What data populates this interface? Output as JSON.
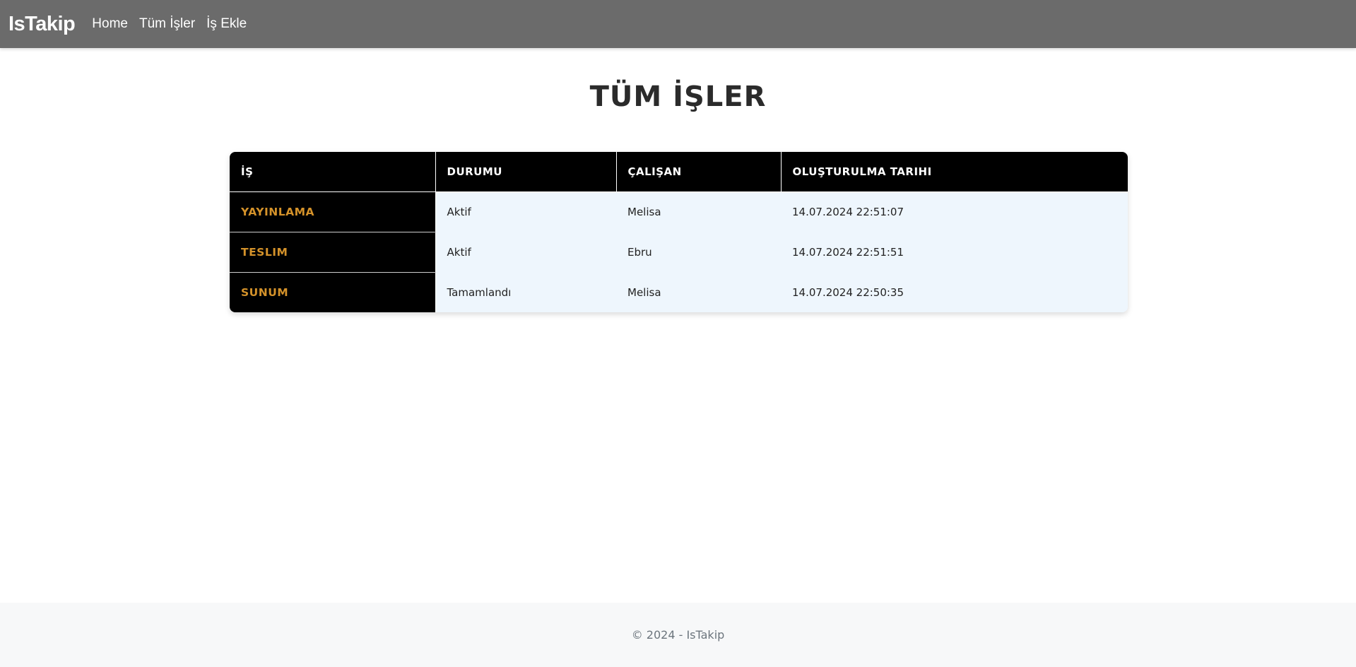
{
  "navbar": {
    "brand": "IsTakip",
    "links": [
      {
        "label": "Home"
      },
      {
        "label": "Tüm İşler"
      },
      {
        "label": "İş Ekle"
      }
    ],
    "background": "#6b6b6b"
  },
  "main": {
    "title": "TÜM İŞLER",
    "table": {
      "headers": [
        "İŞ",
        "DURUMU",
        "ÇALIŞAN",
        "OLUŞTURULMA TARIHI"
      ],
      "rows": [
        {
          "job": "YAYINLAMA",
          "status": "Aktif",
          "employee": "Melisa",
          "created": "14.07.2024 22:51:07"
        },
        {
          "job": "TESLIM",
          "status": "Aktif",
          "employee": "Ebru",
          "created": "14.07.2024 22:51:51"
        },
        {
          "job": "SUNUM",
          "status": "Tamamlandı",
          "employee": "Melisa",
          "created": "14.07.2024 22:50:35"
        }
      ],
      "colors": {
        "header_bg": "#000000",
        "job_text": "#d4922a",
        "row_bg": "#eef6fd"
      }
    }
  },
  "footer": {
    "text": "© 2024 - IsTakip"
  }
}
